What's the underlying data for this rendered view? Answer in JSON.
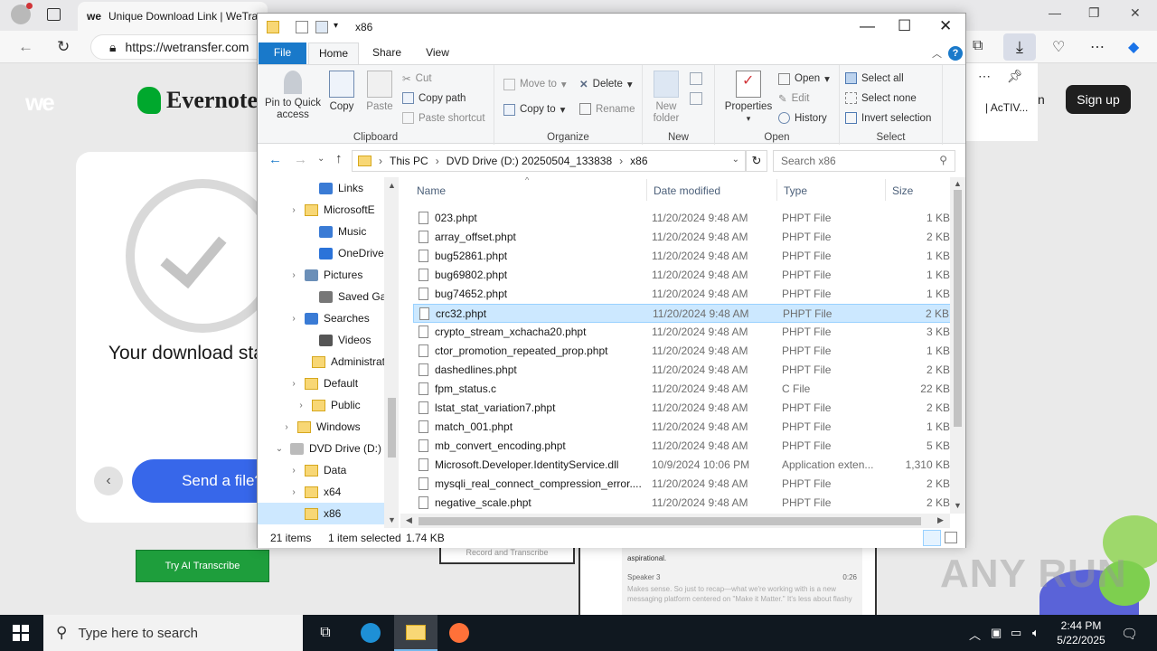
{
  "browser": {
    "tab_title": "Unique Download Link | WeTra",
    "tab_favicon": "we",
    "url": "https://wetransfer.com"
  },
  "webpage": {
    "wt_logo": "we",
    "brand": "Evernote",
    "download_status": "Your download started",
    "send_button": "Send a file?",
    "back_arrow": "‹",
    "try_button": "Try AI Transcribe",
    "signup_button": "Sign up",
    "side_text": "| AcTIV...",
    "side_letter": "n",
    "preview_label": "Record and Transcribe",
    "transcript": {
      "line1": "aspirational.",
      "speaker": "Speaker 3",
      "time": "0:26",
      "body": "Makes sense. So just to recap—what we're working with is a new messaging platform centered on \"Make it Matter.\" It's less about flashy"
    },
    "watermark": "ANY RUN"
  },
  "explorer": {
    "title": "x86",
    "tabs": [
      "File",
      "Home",
      "Share",
      "View"
    ],
    "ribbon": {
      "clipboard": {
        "label": "Clipboard",
        "pin": "Pin to Quick access",
        "copy": "Copy",
        "paste": "Paste",
        "cut": "Cut",
        "copy_path": "Copy path",
        "paste_shortcut": "Paste shortcut"
      },
      "organize": {
        "label": "Organize",
        "move_to": "Move to",
        "copy_to": "Copy to",
        "delete": "Delete",
        "rename": "Rename"
      },
      "new": {
        "label": "New",
        "new_folder": "New folder"
      },
      "open": {
        "label": "Open",
        "properties": "Properties",
        "open": "Open",
        "edit": "Edit",
        "history": "History"
      },
      "select": {
        "label": "Select",
        "select_all": "Select all",
        "select_none": "Select none",
        "invert": "Invert selection"
      }
    },
    "address": {
      "crumbs": [
        "This PC",
        "DVD Drive (D:) 20250504_133838",
        "x86"
      ],
      "search_placeholder": "Search x86"
    },
    "nav": [
      {
        "label": "Links",
        "chev": ""
      },
      {
        "label": "MicrosoftE",
        "chev": "›"
      },
      {
        "label": "Music",
        "chev": ""
      },
      {
        "label": "OneDrive",
        "chev": ""
      },
      {
        "label": "Pictures",
        "chev": "›"
      },
      {
        "label": "Saved Gan",
        "chev": ""
      },
      {
        "label": "Searches",
        "chev": "›"
      },
      {
        "label": "Videos",
        "chev": ""
      },
      {
        "label": "Administrat",
        "chev": ""
      },
      {
        "label": "Default",
        "chev": "›"
      },
      {
        "label": "Public",
        "chev": "›"
      },
      {
        "label": "Windows",
        "chev": "›"
      },
      {
        "label": "DVD Drive (D:)",
        "chev": "⌄"
      },
      {
        "label": "Data",
        "chev": "›"
      },
      {
        "label": "x64",
        "chev": "›"
      },
      {
        "label": "x86",
        "chev": ""
      }
    ],
    "columns": {
      "name": "Name",
      "date": "Date modified",
      "type": "Type",
      "size": "Size"
    },
    "files": [
      {
        "name": "023.phpt",
        "date": "11/20/2024 9:48 AM",
        "type": "PHPT File",
        "size": "1 KB"
      },
      {
        "name": "array_offset.phpt",
        "date": "11/20/2024 9:48 AM",
        "type": "PHPT File",
        "size": "2 KB"
      },
      {
        "name": "bug52861.phpt",
        "date": "11/20/2024 9:48 AM",
        "type": "PHPT File",
        "size": "1 KB"
      },
      {
        "name": "bug69802.phpt",
        "date": "11/20/2024 9:48 AM",
        "type": "PHPT File",
        "size": "1 KB"
      },
      {
        "name": "bug74652.phpt",
        "date": "11/20/2024 9:48 AM",
        "type": "PHPT File",
        "size": "1 KB"
      },
      {
        "name": "crc32.phpt",
        "date": "11/20/2024 9:48 AM",
        "type": "PHPT File",
        "size": "2 KB"
      },
      {
        "name": "crypto_stream_xchacha20.phpt",
        "date": "11/20/2024 9:48 AM",
        "type": "PHPT File",
        "size": "3 KB"
      },
      {
        "name": "ctor_promotion_repeated_prop.phpt",
        "date": "11/20/2024 9:48 AM",
        "type": "PHPT File",
        "size": "1 KB"
      },
      {
        "name": "dashedlines.phpt",
        "date": "11/20/2024 9:48 AM",
        "type": "PHPT File",
        "size": "2 KB"
      },
      {
        "name": "fpm_status.c",
        "date": "11/20/2024 9:48 AM",
        "type": "C File",
        "size": "22 KB"
      },
      {
        "name": "lstat_stat_variation7.phpt",
        "date": "11/20/2024 9:48 AM",
        "type": "PHPT File",
        "size": "2 KB"
      },
      {
        "name": "match_001.phpt",
        "date": "11/20/2024 9:48 AM",
        "type": "PHPT File",
        "size": "1 KB"
      },
      {
        "name": "mb_convert_encoding.phpt",
        "date": "11/20/2024 9:48 AM",
        "type": "PHPT File",
        "size": "5 KB"
      },
      {
        "name": "Microsoft.Developer.IdentityService.dll",
        "date": "10/9/2024 10:06 PM",
        "type": "Application exten...",
        "size": "1,310 KB"
      },
      {
        "name": "mysqli_real_connect_compression_error....",
        "date": "11/20/2024 9:48 AM",
        "type": "PHPT File",
        "size": "2 KB"
      },
      {
        "name": "negative_scale.phpt",
        "date": "11/20/2024 9:48 AM",
        "type": "PHPT File",
        "size": "2 KB"
      }
    ],
    "selected_index": 5,
    "status": {
      "count": "21 items",
      "selected": "1 item selected",
      "size": "1.74 KB"
    }
  },
  "taskbar": {
    "search_placeholder": "Type here to search",
    "time": "2:44 PM",
    "date": "5/22/2025"
  }
}
